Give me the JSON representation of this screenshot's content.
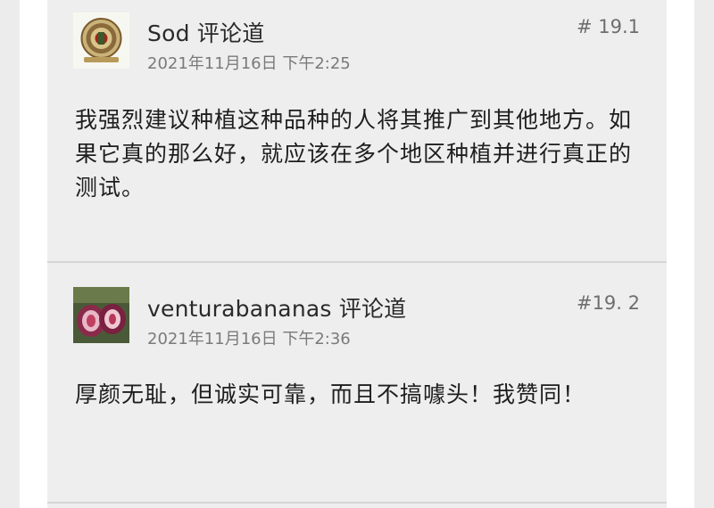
{
  "comments": [
    {
      "author": "Sod",
      "action": "评论道",
      "date": "2021年11月16日 下午2:25",
      "number": "# 19.1",
      "body": "我强烈建议种植这种品种的人将其推广到其他地方。如果它真的那么好，就应该在多个地区种植并进行真正的测试。",
      "avatar_icon": "emblem-seal-icon"
    },
    {
      "author": "venturabananas",
      "action": "评论道",
      "date": "2021年11月16日 下午2:36",
      "number": "#19. 2",
      "body": "厚颜无耻，但诚实可靠，而且不搞噱头！我赞同！",
      "avatar_icon": "fig-fruit-photo-icon"
    }
  ],
  "colors": {
    "background": "#ececec",
    "card": "#eeeeee",
    "divider": "#d6d6d6",
    "text": "#1e1e1e",
    "meta": "#7a7a7a"
  }
}
